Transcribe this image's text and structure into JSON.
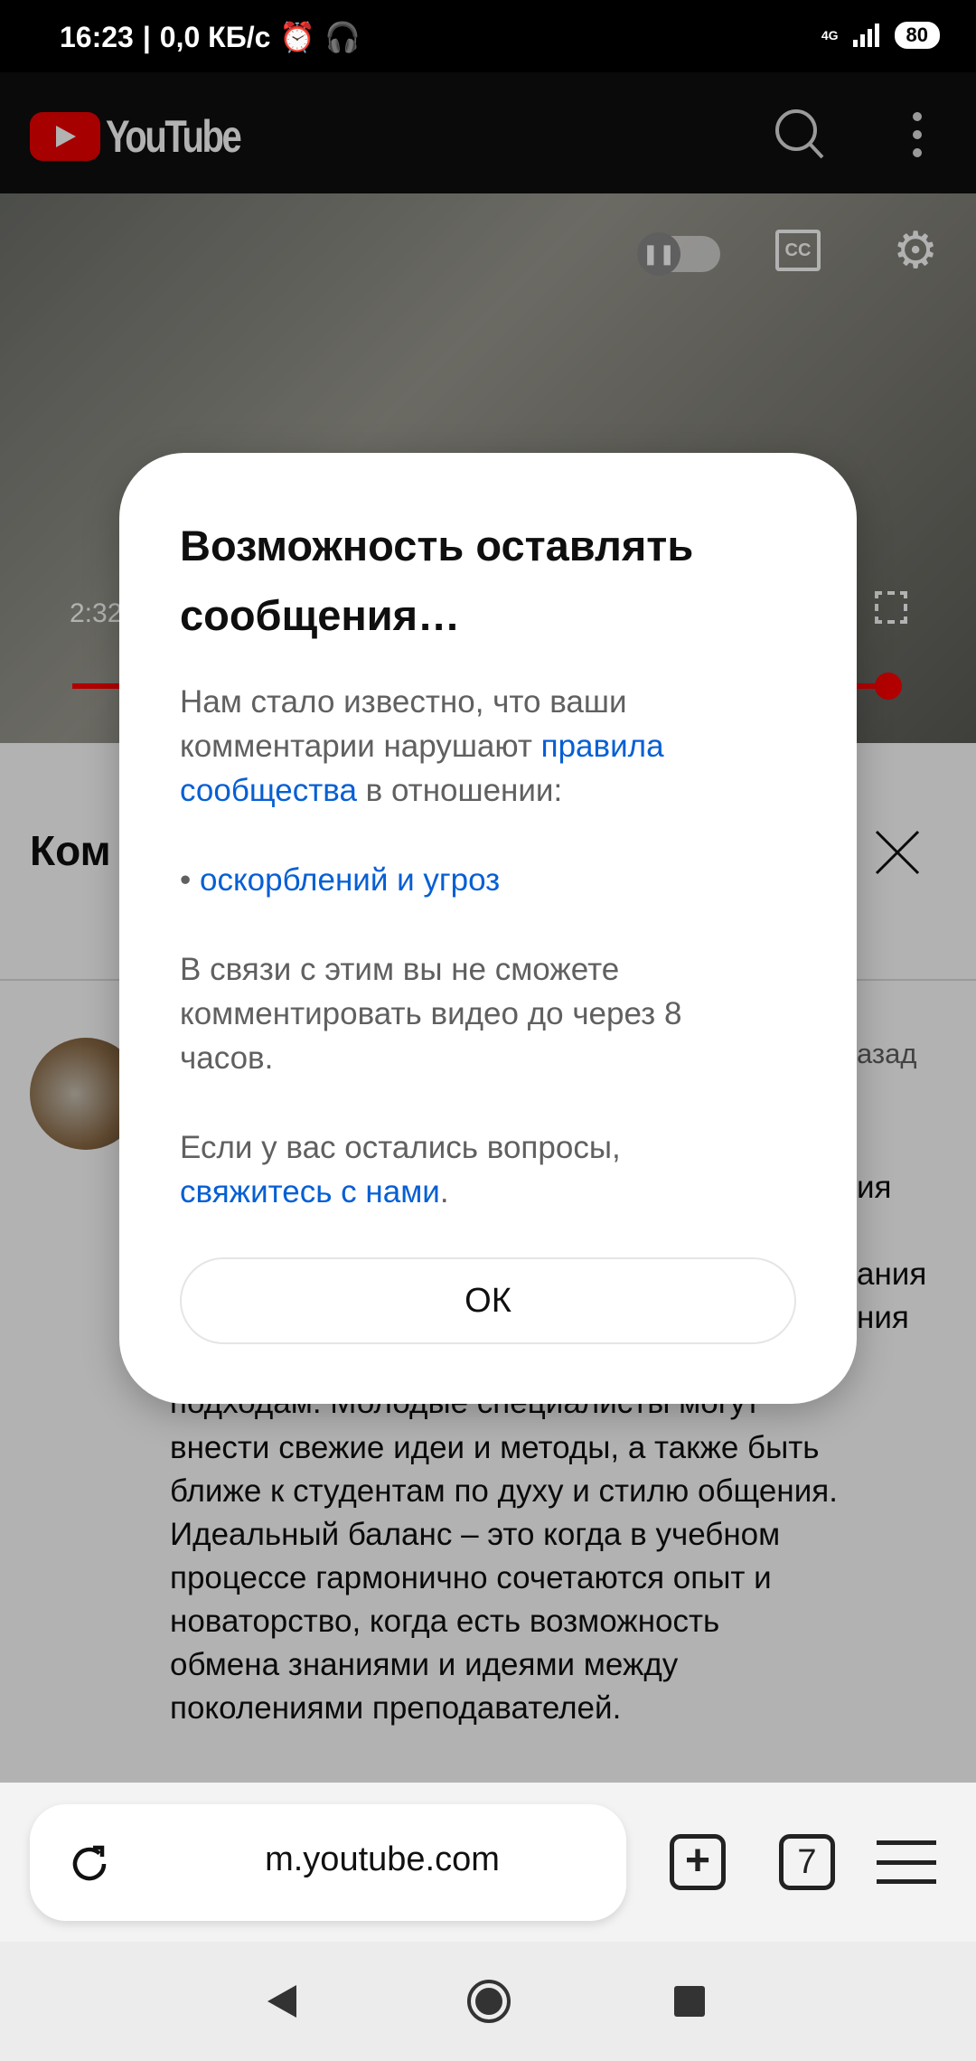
{
  "status_bar": {
    "time": "16:23",
    "speed": "0,0 КБ/с",
    "network": "4G",
    "battery": "80"
  },
  "header": {
    "app_name": "YouTube"
  },
  "video": {
    "current_time": "2:32",
    "accent": "#ff0000",
    "progress_percent": 100
  },
  "comments": {
    "title": "Ком",
    "timestamp_fragment": "азад",
    "hidden_fragments": [
      "ия",
      "ания",
      "ния"
    ],
    "lines": [
      "подходам. Молодые специалисты могут",
      "внести свежие идеи и методы, а также быть",
      "ближе к студентам по духу и стилю общения.",
      "Идеальный баланс – это когда в учебном",
      "процессе гармонично сочетаются опыт и",
      "новаторство, когда есть возможность",
      "обмена знаниями и идеями между",
      "поколениями преподавателей."
    ]
  },
  "dialog": {
    "title_line1": "Возможность оставлять",
    "title_line2": "сообщения…",
    "p1_line1": "Нам стало известно, что ваши",
    "p1_line2_text": "комментарии нарушают ",
    "p1_line2_link": "правила",
    "p1_line3_link": "сообщества",
    "p1_line3_text": " в отношении:",
    "bullet": "• ",
    "bullet_link": "оскорблений и угроз",
    "p2_line1": "В связи с этим вы не сможете",
    "p2_line2": "комментировать видео до через 8",
    "p2_line3": "часов.",
    "p3_line1": "Если у вас остались вопросы,",
    "p3_link": "свяжитесь с нами",
    "p3_end": ".",
    "ok": "ОК",
    "link_color": "#065fd4"
  },
  "browser": {
    "url": "m.youtube.com",
    "tab_count": "7"
  }
}
